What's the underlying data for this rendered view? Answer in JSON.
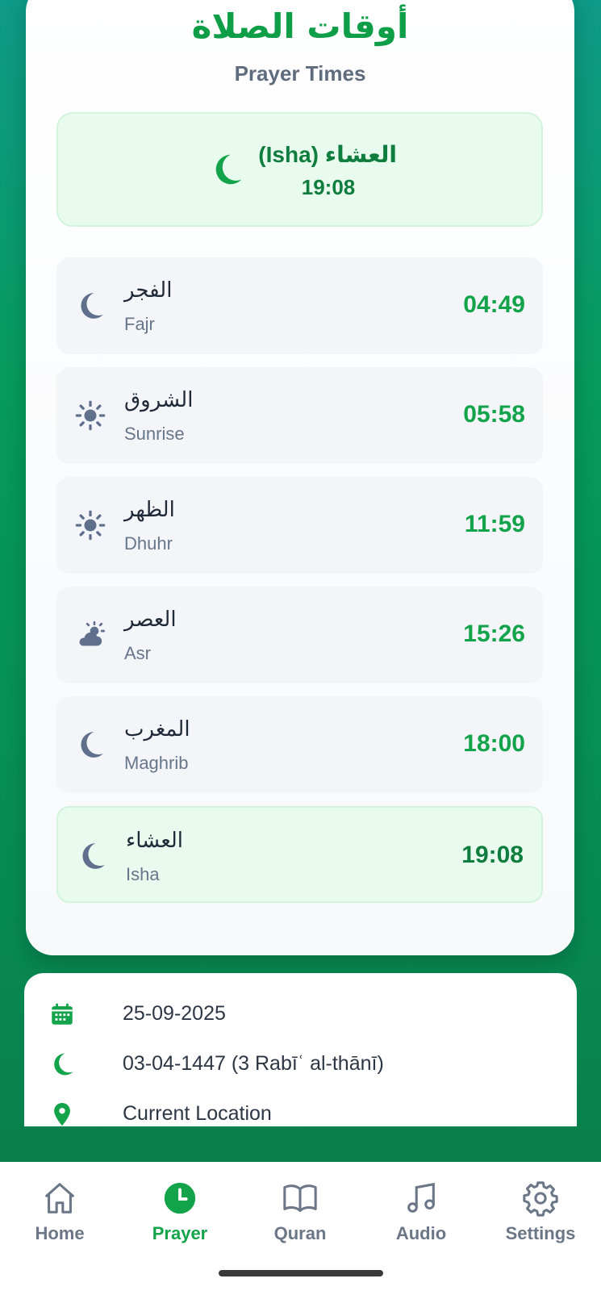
{
  "header": {
    "title_ar": "أوقات الصلاة",
    "title_en": "Prayer Times"
  },
  "next_prayer": {
    "name": "العشاء (Isha)",
    "time": "19:08",
    "icon": "moon-icon"
  },
  "prayers": [
    {
      "ar": "الفجر",
      "en": "Fajr",
      "time": "04:49",
      "icon": "moon-icon"
    },
    {
      "ar": "الشروق",
      "en": "Sunrise",
      "time": "05:58",
      "icon": "sun-icon"
    },
    {
      "ar": "الظهر",
      "en": "Dhuhr",
      "time": "11:59",
      "icon": "sun-icon"
    },
    {
      "ar": "العصر",
      "en": "Asr",
      "time": "15:26",
      "icon": "cloud-sun-icon"
    },
    {
      "ar": "المغرب",
      "en": "Maghrib",
      "time": "18:00",
      "icon": "moon-icon"
    },
    {
      "ar": "العشاء",
      "en": "Isha",
      "time": "19:08",
      "icon": "moon-icon",
      "active": true
    }
  ],
  "info": {
    "gregorian_date": "25-09-2025",
    "hijri_date": "03-04-1447 (3 Rabīʿ al-thānī)",
    "location": "Current Location"
  },
  "tabs": [
    {
      "label": "Home",
      "icon": "home-icon"
    },
    {
      "label": "Prayer",
      "icon": "clock-icon",
      "active": true
    },
    {
      "label": "Quran",
      "icon": "book-icon"
    },
    {
      "label": "Audio",
      "icon": "music-note-icon"
    },
    {
      "label": "Settings",
      "icon": "gear-icon"
    }
  ],
  "colors": {
    "accent": "#13a34a",
    "accent_dark": "#0f7d3d",
    "icon_slate": "#5f6f8c",
    "highlight_bg": "#e9fbee"
  }
}
